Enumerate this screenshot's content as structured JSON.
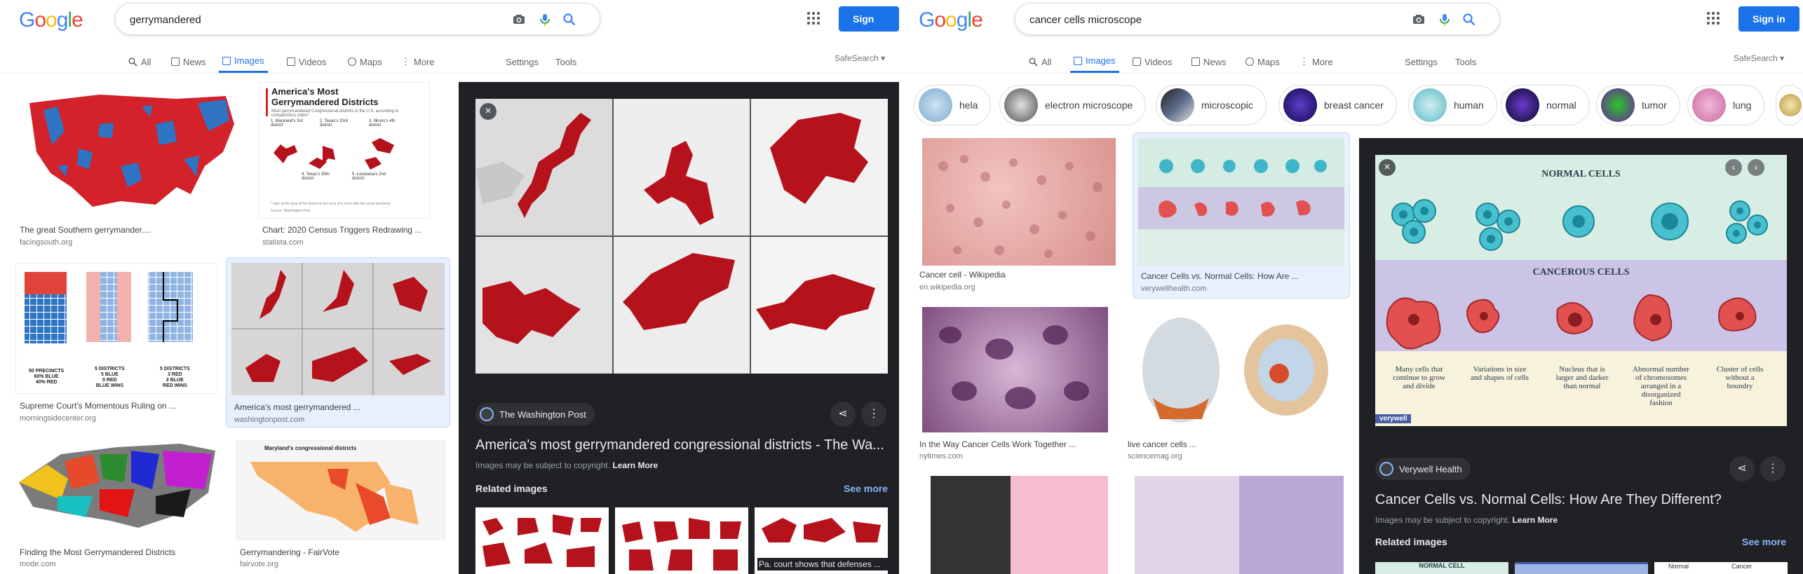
{
  "left": {
    "logo": "Google",
    "query": "gerrymandered",
    "signin": "Sign in",
    "tabs": [
      "All",
      "News",
      "Images",
      "Videos",
      "Maps",
      "More",
      "Settings",
      "Tools"
    ],
    "safesearch": "SafeSearch ▾",
    "results": [
      {
        "caption": "The great Southern gerrymander....",
        "source": "facingsouth.org"
      },
      {
        "caption": "Chart: 2020 Census Triggers Redrawing ...",
        "source": "statista.com"
      },
      {
        "caption": "Supreme Court's Momentous Ruling on ...",
        "source": "morningsidecenter.org"
      },
      {
        "caption": "America's most gerrymandered ...",
        "source": "washingtonpost.com"
      },
      {
        "caption": "Finding the Most Gerrymandered Districts",
        "source": "mode.com"
      },
      {
        "caption": "Gerrymandering - FairVote",
        "source": "fairvote.org"
      }
    ],
    "statista": {
      "title1": "America's Most",
      "title2": "Gerrymandered Districts",
      "sub": "Most gerrymandered Congressional districts in the U.S. according to compactness index*",
      "labels": [
        "1. Maryland's 3rd district",
        "2. Texas's 33rd district",
        "3. Illinois's 4th district",
        "4. Texas's 35th district",
        "5. Louisiana's 2nd district"
      ],
      "foot": "* ratio of the area of the district to the area of a circle with the same perimeter",
      "src": "Source: Washington Post"
    },
    "grid_labels": {
      "c1": [
        "50 PRECINCTS",
        "60% BLUE",
        "40% RED"
      ],
      "c2": [
        "5 DISTRICTS",
        "5 BLUE",
        "0 RED",
        "BLUE WINS"
      ],
      "c3": [
        "5 DISTRICTS",
        "3 RED",
        "2 BLUE",
        "RED WINS"
      ]
    },
    "fairvote_title": "Maryland's congressional districts",
    "panel": {
      "source": "The Washington Post",
      "title": "America's most gerrymandered congressional districts - The Wa...",
      "note": "Images may be subject to copyright. ",
      "learn": "Learn More",
      "related": "Related images",
      "see_more": "See more",
      "rel3_caption": "Pa. court shows that defenses ..."
    }
  },
  "right": {
    "logo": "Google",
    "query": "cancer cells microscope",
    "signin": "Sign in",
    "tabs": [
      "All",
      "Images",
      "Videos",
      "News",
      "Maps",
      "More",
      "Settings",
      "Tools"
    ],
    "safesearch": "SafeSearch ▾",
    "chips": [
      "hela",
      "electron microscope",
      "microscopic",
      "breast cancer",
      "human",
      "normal",
      "tumor",
      "lung"
    ],
    "results": [
      {
        "caption": "Cancer cell - Wikipedia",
        "source": "en.wikipedia.org"
      },
      {
        "caption": "Cancer Cells vs. Normal Cells: How Are ...",
        "source": "verywellhealth.com"
      },
      {
        "caption": "In the Way Cancer Cells Work Together ...",
        "source": "nytimes.com"
      },
      {
        "caption": "live cancer cells ...",
        "source": "sciencemag.org"
      }
    ],
    "infographic": {
      "normal": "NORMAL CELLS",
      "cancerous": "CANCEROUS CELLS",
      "descs": [
        "Many cells that continue to grow and divide",
        "Variations in size and shapes of cells",
        "Nucleus that is larger and darker than normal",
        "Abnormal number of chromosomes arranged in a disorganized fashion",
        "Cluster of cells without a boundry"
      ],
      "brand": "verywell"
    },
    "panel": {
      "source": "Verywell Health",
      "title": "Cancer Cells vs. Normal Cells: How Are They Different?",
      "note": "Images may be subject to copyright. ",
      "learn": "Learn More",
      "related": "Related images",
      "see_more": "See more",
      "rel_labels": [
        "NORMAL CELL",
        "Normal",
        "Cancer"
      ]
    }
  },
  "colors": {
    "accent": "#1a73e8",
    "gerrymander_red": "#b5121b",
    "panel_bg": "#202124"
  }
}
